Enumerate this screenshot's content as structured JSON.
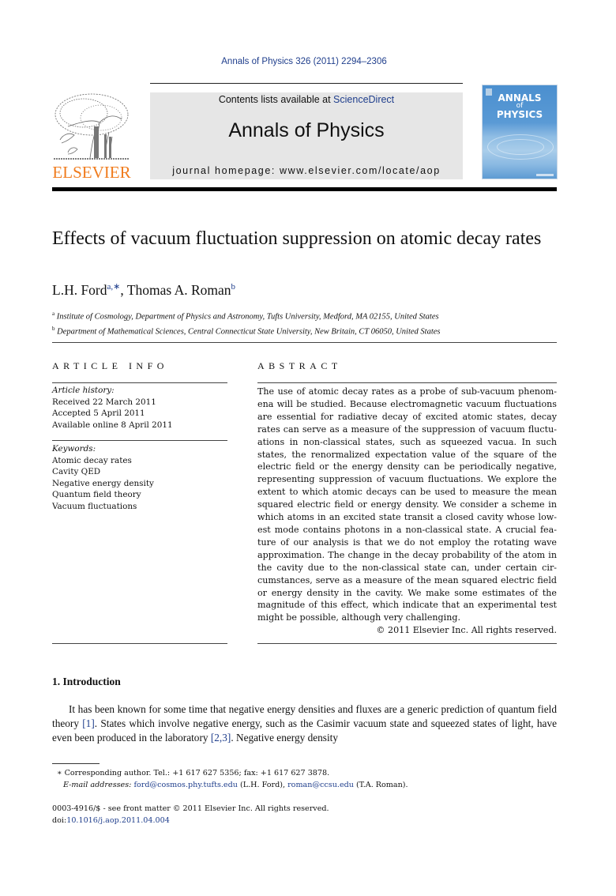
{
  "journal_ref": "Annals of Physics 326 (2011) 2294–2306",
  "masthead": {
    "contents_prefix": "Contents lists available at ",
    "contents_link": "ScienceDirect",
    "journal_name": "Annals of Physics",
    "homepage": "journal homepage: www.elsevier.com/locate/aop"
  },
  "publisher_logo": {
    "wordmark": "ELSEVIER",
    "color": "#f07c1e"
  },
  "cover": {
    "line1": "ANNALS",
    "line2": "of",
    "line3": "PHYSICS"
  },
  "article": {
    "title": "Effects of vacuum fluctuation suppression on atomic decay rates",
    "authors": [
      {
        "name": "L.H. Ford",
        "marks": "a,∗"
      },
      {
        "name": "Thomas A. Roman",
        "marks": "b"
      }
    ],
    "author_separator": ", ",
    "affiliations": [
      {
        "mark": "a",
        "text": "Institute of Cosmology, Department of Physics and Astronomy, Tufts University, Medford, MA 02155, United States"
      },
      {
        "mark": "b",
        "text": "Department of Mathematical Sciences, Central Connecticut State University, New Britain, CT 06050, United States"
      }
    ]
  },
  "article_info": {
    "heading": "ARTICLE INFO",
    "history_label": "Article history:",
    "history": [
      "Received 22 March 2011",
      "Accepted 5 April 2011",
      "Available online 8 April 2011"
    ],
    "keywords_label": "Keywords:",
    "keywords": [
      "Atomic decay rates",
      "Cavity QED",
      "Negative energy density",
      "Quantum field theory",
      "Vacuum fluctuations"
    ]
  },
  "abstract": {
    "heading": "ABSTRACT",
    "text": "The use of atomic decay rates as a probe of sub-vacuum phenom­ena will be studied. Because electromagnetic vacuum fluctuations are essential for radiative decay of excited atomic states, decay rates can serve as a measure of the suppression of vacuum fluctu­ations in non-classical states, such as squeezed vacua. In such states, the renormalized expectation value of the square of the electric field or the energy density can be periodically negative, representing suppression of vacuum fluctuations. We explore the extent to which atomic decays can be used to measure the mean squared electric field or energy density. We consider a scheme in which atoms in an excited state transit a closed cavity whose low­est mode contains photons in a non-classical state. A crucial fea­ture of our analysis is that we do not employ the rotating wave approximation. The change in the decay probability of the atom in the cavity due to the non-classical state can, under certain cir­cumstances, serve as a measure of the mean squared electric field or energy density in the cavity. We make some estimates of the magnitude of this effect, which indicate that an experimental test might be possible, although very challenging.",
    "copyright": "© 2011 Elsevier Inc. All rights reserved."
  },
  "introduction": {
    "heading": "1. Introduction",
    "seg1": "It has been known for some time that negative energy densities and fluxes are a generic prediction of quantum field theory ",
    "ref1": "[1]",
    "seg2": ". States which involve negative energy, such as the Casimir vacuum state and squeezed states of light, have even been produced in the laboratory ",
    "ref2": "[2,3]",
    "seg3": ". Negative energy density"
  },
  "footnotes": {
    "corresponding": "∗  Corresponding author. Tel.: +1 617 627 5356; fax: +1 617 627 3878.",
    "email_label": "E-mail addresses:",
    "email1": "ford@cosmos.phy.tufts.edu",
    "email1_owner": " (L.H. Ford), ",
    "email2": "roman@ccsu.edu",
    "email2_owner": " (T.A. Roman)."
  },
  "front_matter": {
    "issn_line": "0003-4916/$ - see front matter © 2011 Elsevier Inc. All rights reserved.",
    "doi_prefix": "doi:",
    "doi": "10.1016/j.aop.2011.04.004"
  },
  "colors": {
    "link": "#1f3e8c",
    "elsevier_orange": "#f07c1e",
    "masthead_bg": "#e6e6e6"
  }
}
